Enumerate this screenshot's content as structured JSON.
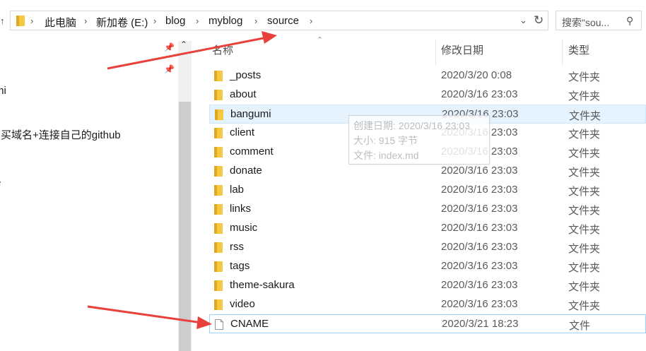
{
  "colors": {
    "accent": "#e8413c",
    "folder": "#f5c842",
    "hover": "#e5f3ff"
  },
  "breadcrumb": {
    "items": [
      "此电脑",
      "新加卷 (E:)",
      "blog",
      "myblog",
      "source"
    ]
  },
  "search": {
    "placeholder": "搜索\"sou..."
  },
  "left_pane": {
    "items": [
      "mi",
      "购买域名+连接自己的github",
      "e"
    ]
  },
  "columns": {
    "name": "名称",
    "modified": "修改日期",
    "type": "类型"
  },
  "files": [
    {
      "name": "_posts",
      "date": "2020/3/20 0:08",
      "type": "文件夹",
      "icon": "folder-icon"
    },
    {
      "name": "about",
      "date": "2020/3/16 23:03",
      "type": "文件夹",
      "icon": "folder-icon"
    },
    {
      "name": "bangumi",
      "date": "2020/3/16 23:03",
      "type": "文件夹",
      "icon": "folder-icon"
    },
    {
      "name": "client",
      "date": "2020/3/16 23:03",
      "type": "文件夹",
      "icon": "folder-icon"
    },
    {
      "name": "comment",
      "date": "2020/3/16 23:03",
      "type": "文件夹",
      "icon": "folder-icon"
    },
    {
      "name": "donate",
      "date": "2020/3/16 23:03",
      "type": "文件夹",
      "icon": "folder-icon"
    },
    {
      "name": "lab",
      "date": "2020/3/16 23:03",
      "type": "文件夹",
      "icon": "folder-icon"
    },
    {
      "name": "links",
      "date": "2020/3/16 23:03",
      "type": "文件夹",
      "icon": "folder-icon"
    },
    {
      "name": "music",
      "date": "2020/3/16 23:03",
      "type": "文件夹",
      "icon": "folder-icon"
    },
    {
      "name": "rss",
      "date": "2020/3/16 23:03",
      "type": "文件夹",
      "icon": "folder-icon"
    },
    {
      "name": "tags",
      "date": "2020/3/16 23:03",
      "type": "文件夹",
      "icon": "folder-icon"
    },
    {
      "name": "theme-sakura",
      "date": "2020/3/16 23:03",
      "type": "文件夹",
      "icon": "folder-icon"
    },
    {
      "name": "video",
      "date": "2020/3/16 23:03",
      "type": "文件夹",
      "icon": "folder-icon"
    },
    {
      "name": "CNAME",
      "date": "2020/3/21 18:23",
      "type": "文件",
      "icon": "file-icon"
    }
  ],
  "tooltip": {
    "created": "创建日期: 2020/3/16 23:03",
    "size": "大小: 915 字节",
    "files": "文件: index.md"
  }
}
